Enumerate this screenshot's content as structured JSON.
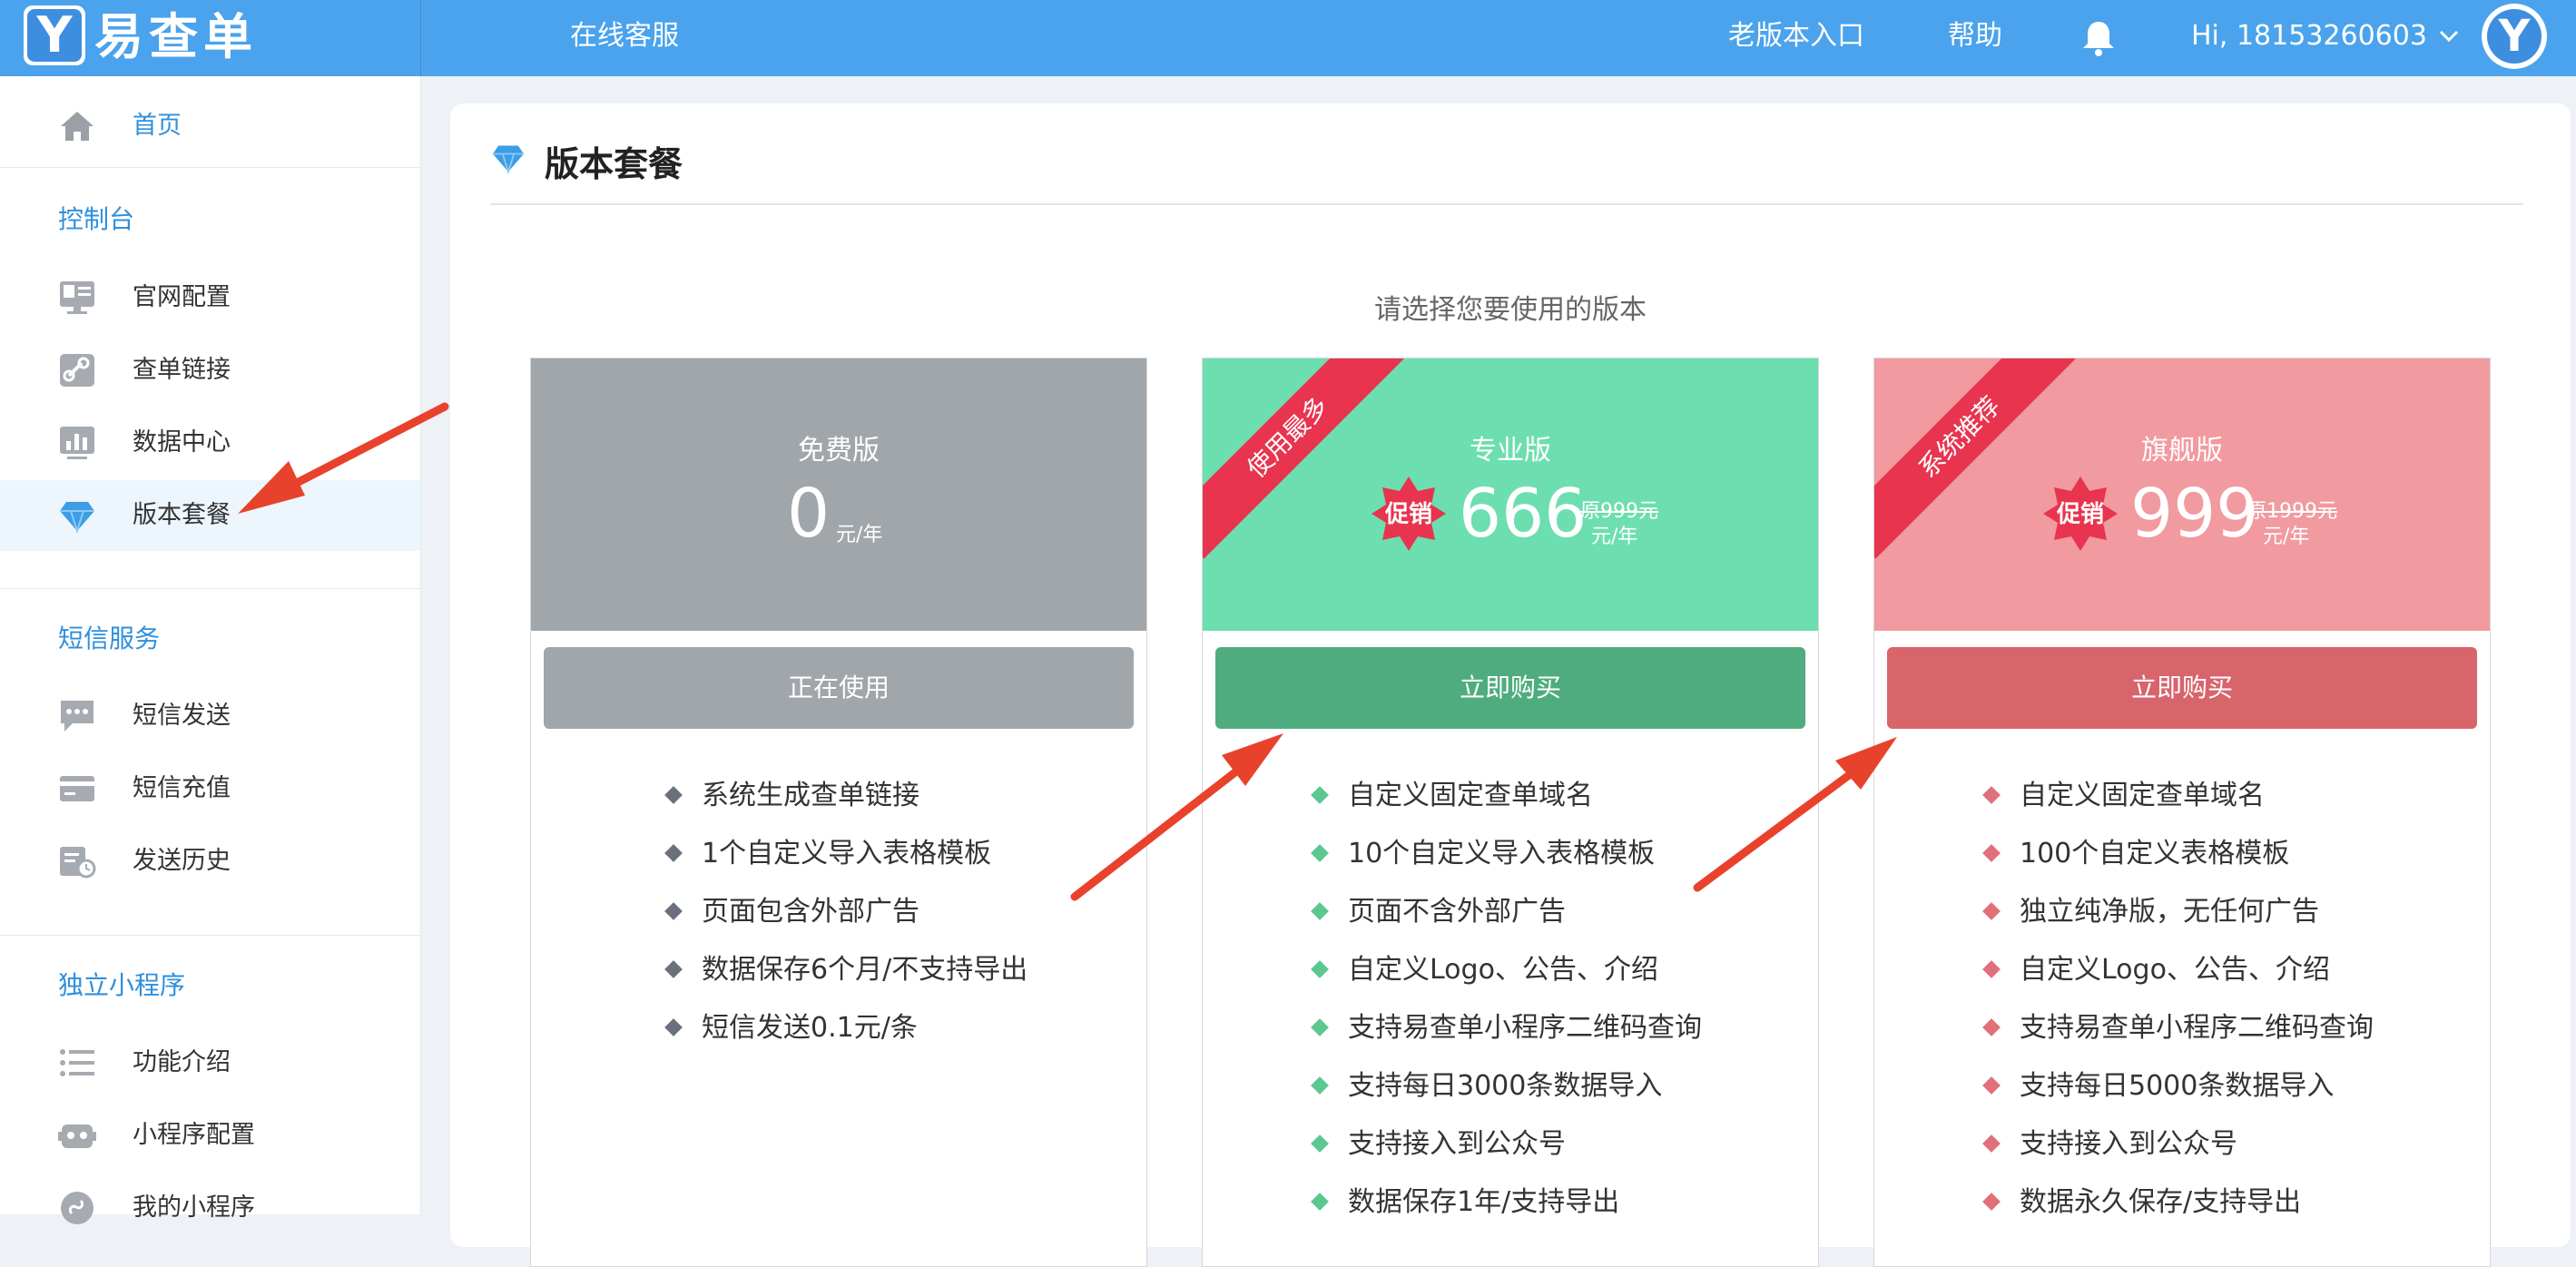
{
  "header": {
    "logo_letter": "Y",
    "logo_text": "易查单",
    "online_service": "在线客服",
    "old_version": "老版本入口",
    "help": "帮助",
    "user_greeting": "Hi, 18153260603",
    "avatar_letter": "Y"
  },
  "sidebar": {
    "home": "首页",
    "sections": [
      {
        "title": "控制台",
        "items": [
          "官网配置",
          "查单链接",
          "数据中心",
          "版本套餐"
        ]
      },
      {
        "title": "短信服务",
        "items": [
          "短信发送",
          "短信充值",
          "发送历史"
        ]
      },
      {
        "title": "独立小程序",
        "items": [
          "功能介绍",
          "小程序配置",
          "我的小程序"
        ]
      }
    ],
    "active_item": "版本套餐"
  },
  "page": {
    "title": "版本套餐",
    "subtitle": "请选择您要使用的版本"
  },
  "plans": [
    {
      "name": "免费版",
      "price": "0",
      "unit": "元/年",
      "button": "正在使用",
      "color": "#a1a6ab",
      "button_color": "#a1a6ab",
      "bullet_color": "#6b717c",
      "features": [
        "系统生成查单链接",
        "1个自定义导入表格模板",
        "页面包含外部广告",
        "数据保存6个月/不支持导出",
        "短信发送0.1元/条"
      ]
    },
    {
      "name": "专业版",
      "ribbon": "使用最多",
      "promo": "促销",
      "price": "666",
      "original": "原999元",
      "unit": "元/年",
      "button": "立即购买",
      "color": "#6ddeb0",
      "button_color": "#4fac7e",
      "bullet_color": "#5cc88f",
      "features": [
        "自定义固定查单域名",
        "10个自定义导入表格模板",
        "页面不含外部广告",
        "自定义Logo、公告、介绍",
        "支持易查单小程序二维码查询",
        "支持每日3000条数据导入",
        "支持接入到公众号",
        "数据保存1年/支持导出"
      ]
    },
    {
      "name": "旗舰版",
      "ribbon": "系统推荐",
      "promo": "促销",
      "price": "999",
      "original": "原1999元",
      "unit": "元/年",
      "button": "立即购买",
      "color": "#f19aa0",
      "button_color": "#d8646c",
      "bullet_color": "#e0707a",
      "features": [
        "自定义固定查单域名",
        "100个自定义表格模板",
        "独立纯净版，无任何广告",
        "自定义Logo、公告、介绍",
        "支持易查单小程序二维码查询",
        "支持每日5000条数据导入",
        "支持接入到公众号",
        "数据永久保存/支持导出"
      ]
    }
  ],
  "colors": {
    "header_bg": "#4aa3ec",
    "accent": "#2f8fdc",
    "ribbon": "#e8344e",
    "arrow": "#e8422c"
  }
}
